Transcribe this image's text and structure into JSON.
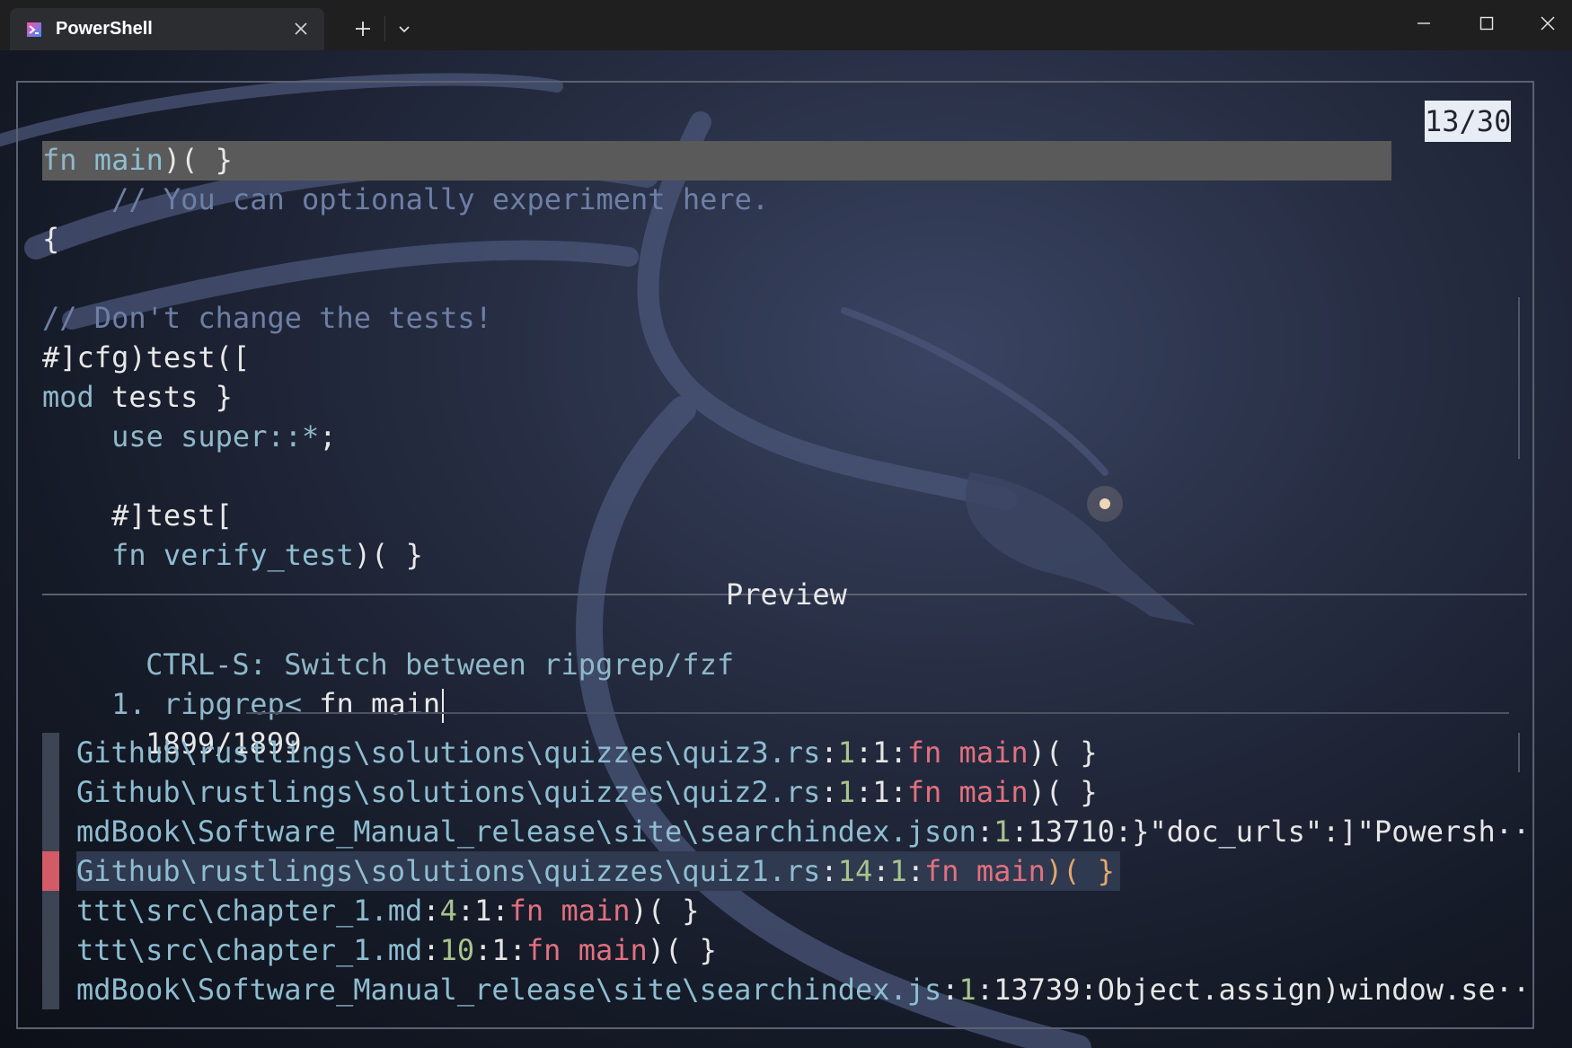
{
  "window": {
    "tab_title": "PowerShell",
    "new_tab_symbol": "+",
    "icons": [
      "powershell-icon",
      "close-icon",
      "plus-icon",
      "chevron-down-icon",
      "minimize-icon",
      "maximize-icon",
      "window-close-icon"
    ]
  },
  "preview": {
    "counter": "13/30",
    "lines": [
      {
        "parts": [
          {
            "t": "fn ",
            "c": "kw"
          },
          {
            "t": "main",
            "c": "fn"
          },
          {
            "t": ")( }",
            "c": "wh"
          }
        ]
      },
      {
        "parts": [
          {
            "t": "    // You can optionally experiment here.",
            "c": "cm"
          }
        ]
      },
      {
        "parts": [
          {
            "t": "{",
            "c": "wh"
          }
        ]
      },
      {
        "parts": [
          {
            "t": "",
            "c": "wh"
          }
        ]
      },
      {
        "parts": [
          {
            "t": "// Don't change the tests!",
            "c": "cm"
          }
        ]
      },
      {
        "parts": [
          {
            "t": "#]cfg)test([",
            "c": "wh"
          }
        ]
      },
      {
        "parts": [
          {
            "t": "mod ",
            "c": "kw"
          },
          {
            "t": "tests }",
            "c": "wh"
          }
        ]
      },
      {
        "parts": [
          {
            "t": "    use super::*",
            "c": "kw"
          },
          {
            "t": ";",
            "c": "wh"
          }
        ]
      },
      {
        "parts": [
          {
            "t": "",
            "c": "wh"
          }
        ]
      },
      {
        "parts": [
          {
            "t": "    #]test[",
            "c": "wh"
          }
        ]
      },
      {
        "parts": [
          {
            "t": "    fn ",
            "c": "kw"
          },
          {
            "t": "verify_test",
            "c": "fn"
          },
          {
            "t": ")( }",
            "c": "wh"
          }
        ]
      }
    ],
    "label": "Preview"
  },
  "prompt": {
    "hint": "CTRL-S: Switch between ripgrep/fzf",
    "index": "1.",
    "mode": "ripgrep<",
    "query": "fn main",
    "count": "1899/1899"
  },
  "results": [
    {
      "path": "Github\\rustlings\\solutions\\quizzes\\quiz3.rs",
      "line": "1",
      "col": "1",
      "match": "fn main",
      "rest": ")( }",
      "selected": false
    },
    {
      "path": "Github\\rustlings\\solutions\\quizzes\\quiz2.rs",
      "line": "1",
      "col": "1",
      "match": "fn main",
      "rest": ")( }",
      "selected": false
    },
    {
      "path": "mdBook\\Software_Manual_release\\site\\searchindex.json",
      "line": "1",
      "col": "13710",
      "match": "",
      "rest": "}\"doc_urls\":]\"Powersh··",
      "selected": false
    },
    {
      "path": "Github\\rustlings\\solutions\\quizzes\\quiz1.rs",
      "line": "14",
      "col": "1",
      "match": "fn main",
      "rest": ")( }",
      "selected": true
    },
    {
      "path": "ttt\\src\\chapter_1.md",
      "line": "4",
      "col": "1",
      "match": "fn main",
      "rest": ")( }",
      "selected": false
    },
    {
      "path": "ttt\\src\\chapter_1.md",
      "line": "10",
      "col": "1",
      "match": "fn main",
      "rest": ")( }",
      "selected": false
    },
    {
      "path": "mdBook\\Software_Manual_release\\site\\searchindex.js",
      "line": "1",
      "col": "13739",
      "match": "",
      "rest": "Object.assign)window.se··",
      "selected": false
    }
  ]
}
